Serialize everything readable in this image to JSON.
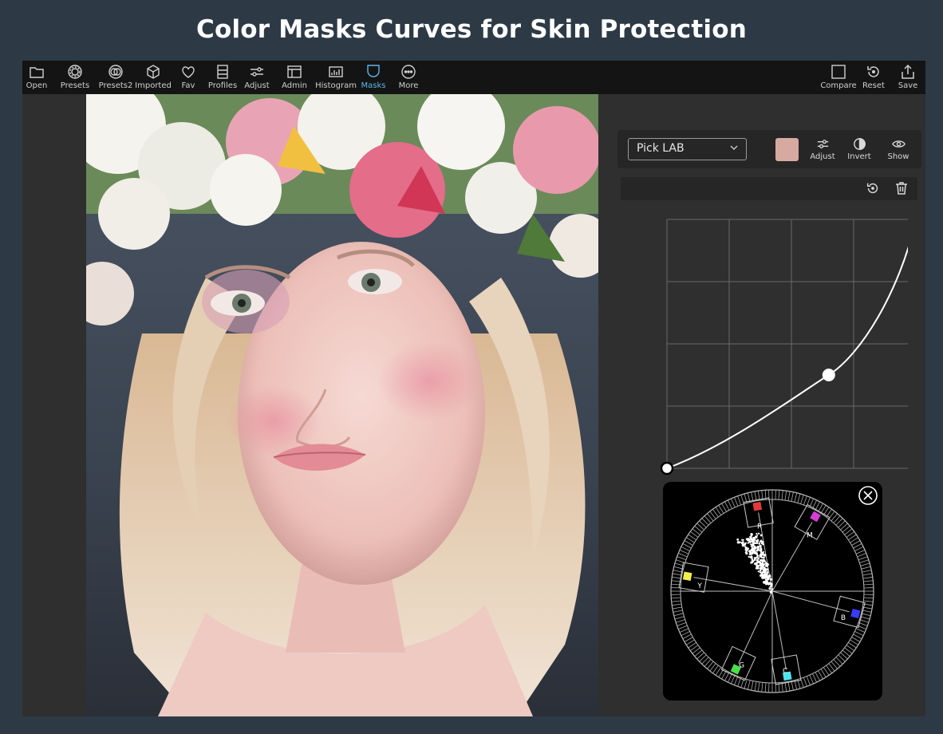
{
  "banner": {
    "title": "Color Masks Curves for Skin Protection"
  },
  "toolbar": {
    "left": [
      {
        "icon": "folder-icon",
        "label": "Open"
      },
      {
        "icon": "presets-icon",
        "label": "Presets"
      },
      {
        "icon": "presets2-icon",
        "label": "Presets2"
      },
      {
        "icon": "cube-icon",
        "label": "Imported"
      },
      {
        "icon": "heart-icon",
        "label": "Fav"
      },
      {
        "icon": "profiles-icon",
        "label": "Profiles"
      },
      {
        "icon": "sliders-icon",
        "label": "Adjust"
      },
      {
        "icon": "admin-icon",
        "label": "Admin"
      },
      {
        "icon": "histogram-icon",
        "label": "Histogram"
      },
      {
        "icon": "mask-icon",
        "label": "Masks",
        "active": true
      },
      {
        "icon": "more-icon",
        "label": "More"
      }
    ],
    "right": [
      {
        "icon": "compare-icon",
        "label": "Compare"
      },
      {
        "icon": "reset-icon",
        "label": "Reset"
      },
      {
        "icon": "share-icon",
        "label": "Save"
      }
    ],
    "active_color": "#5ab8e8"
  },
  "mask_panel": {
    "mode_select": "Pick LAB",
    "swatch_color": "#d6aaa0",
    "tools": [
      {
        "icon": "sliders-icon",
        "label": "Adjust"
      },
      {
        "icon": "invert-icon",
        "label": "Invert"
      },
      {
        "icon": "eye-icon",
        "label": "Show"
      }
    ]
  },
  "curve": {
    "points": [
      {
        "x": 0.0,
        "y": 0.0
      },
      {
        "x": 0.65,
        "y": 0.375
      },
      {
        "x": 1.0,
        "y": 1.0
      }
    ]
  },
  "vectorscope": {
    "targets": [
      {
        "label": "R",
        "color": "#e23b3b"
      },
      {
        "label": "M",
        "color": "#d63fd6"
      },
      {
        "label": "Y",
        "color": "#f1f04a"
      },
      {
        "label": "B",
        "color": "#3b3bff"
      },
      {
        "label": "G",
        "color": "#4be04b"
      },
      {
        "label": "C",
        "color": "#4fe6ea"
      }
    ]
  }
}
